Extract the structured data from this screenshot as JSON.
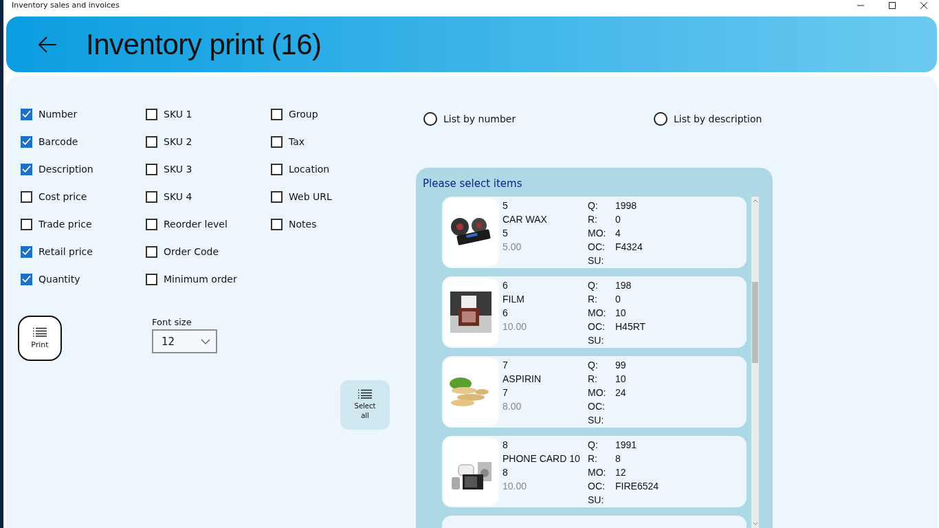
{
  "window": {
    "title": "Inventory sales and invoices"
  },
  "header": {
    "title": "Inventory print (16)"
  },
  "fields": [
    {
      "label": "Number",
      "checked": true
    },
    {
      "label": "Barcode",
      "checked": true
    },
    {
      "label": "Description",
      "checked": true
    },
    {
      "label": "Cost price",
      "checked": false
    },
    {
      "label": "Trade price",
      "checked": false
    },
    {
      "label": "Retail price",
      "checked": true
    },
    {
      "label": "Quantity",
      "checked": true
    },
    {
      "label": "SKU 1",
      "checked": false
    },
    {
      "label": "SKU 2",
      "checked": false
    },
    {
      "label": "SKU 3",
      "checked": false
    },
    {
      "label": "SKU 4",
      "checked": false
    },
    {
      "label": "Reorder level",
      "checked": false
    },
    {
      "label": "Order Code",
      "checked": false
    },
    {
      "label": "Minimum order",
      "checked": false
    },
    {
      "label": "Group",
      "checked": false
    },
    {
      "label": "Tax",
      "checked": false
    },
    {
      "label": "Location",
      "checked": false
    },
    {
      "label": "Web URL",
      "checked": false
    },
    {
      "label": "Notes",
      "checked": false
    }
  ],
  "sort_options": [
    {
      "label": "List by number",
      "selected": false
    },
    {
      "label": "List by description",
      "selected": false
    }
  ],
  "print_button": {
    "label": "Print"
  },
  "font_size": {
    "label": "Font size",
    "value": "12"
  },
  "select_all_button": {
    "label": "Select\nall"
  },
  "items_panel": {
    "title": "Please select items",
    "items": [
      {
        "kind": "item",
        "number": "5",
        "description": "CAR WAX",
        "barcode": "5",
        "price": "5.00",
        "details": [
          {
            "label": "Q:",
            "value": "1998"
          },
          {
            "label": "R:",
            "value": "0"
          },
          {
            "label": "MO:",
            "value": "4"
          },
          {
            "label": "OC:",
            "value": "F4324"
          },
          {
            "label": "SU:"
          }
        ]
      },
      {
        "kind": "item",
        "number": "6",
        "description": "FILM",
        "barcode": "6",
        "price": "10.00",
        "details": [
          {
            "label": "Q:",
            "value": "198"
          },
          {
            "label": "R:",
            "value": "0"
          },
          {
            "label": "MO:",
            "value": "10"
          },
          {
            "label": "OC:",
            "value": "H45RT"
          },
          {
            "label": "SU:"
          }
        ]
      },
      {
        "kind": "item",
        "number": "7",
        "description": "ASPIRIN",
        "barcode": "7",
        "price": "8.00",
        "details": [
          {
            "label": "Q:",
            "value": "99"
          },
          {
            "label": "R:",
            "value": "10"
          },
          {
            "label": "MO:",
            "value": "24"
          },
          {
            "label": "OC:"
          },
          {
            "label": "SU:"
          }
        ]
      },
      {
        "kind": "item",
        "number": "8",
        "description": "PHONE CARD 10",
        "barcode": "8",
        "price": "10.00",
        "details": [
          {
            "label": "Q:",
            "value": "1991"
          },
          {
            "label": "R:",
            "value": "8"
          },
          {
            "label": "MO:",
            "value": "12"
          },
          {
            "label": "OC:",
            "value": "FIRE6524"
          },
          {
            "label": "SU:"
          }
        ]
      },
      {
        "kind": "partial"
      }
    ]
  }
}
